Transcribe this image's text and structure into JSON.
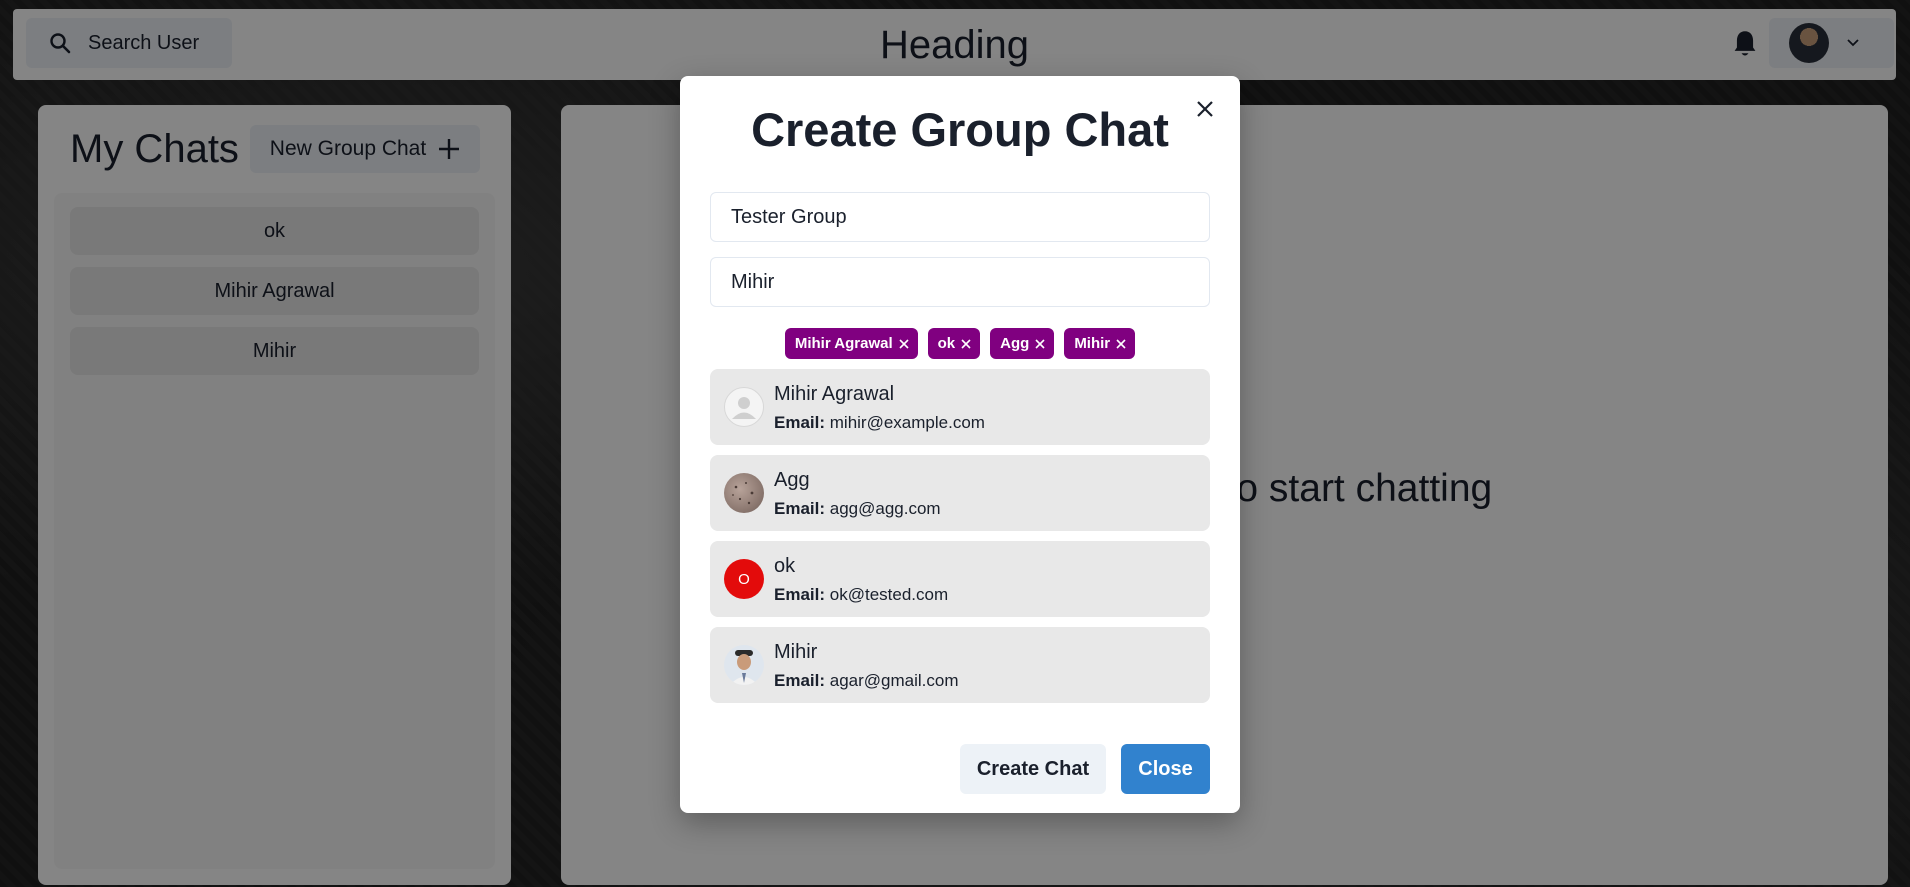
{
  "header": {
    "search_label": "Search User",
    "heading": "Heading",
    "bell_icon": "bell-icon",
    "chevron_icon": "chevron-down-icon"
  },
  "chats_panel": {
    "title": "My Chats",
    "new_group_label": "New Group Chat",
    "items": [
      "ok",
      "Mihir Agrawal",
      "Mihir"
    ]
  },
  "main": {
    "empty_message": "Click on a user to start chatting"
  },
  "modal": {
    "title": "Create Group Chat",
    "group_name_value": "Tester Group",
    "search_value": "Mihir",
    "selected_tags": [
      "Mihir Agrawal",
      "ok",
      "Agg",
      "Mihir"
    ],
    "email_label": "Email:",
    "results": [
      {
        "name": "Mihir Agrawal",
        "email": "mihir@example.com",
        "avatar": "default"
      },
      {
        "name": "Agg",
        "email": "agg@agg.com",
        "avatar": "photo-texture"
      },
      {
        "name": "ok",
        "email": "ok@tested.com",
        "avatar": "initial",
        "initial": "O"
      },
      {
        "name": "Mihir",
        "email": "agar@gmail.com",
        "avatar": "photo-person"
      }
    ],
    "create_label": "Create Chat",
    "close_label": "Close"
  },
  "colors": {
    "tag": "#800080",
    "primary": "#3182ce",
    "initial_avatar": "#e30b0b"
  }
}
